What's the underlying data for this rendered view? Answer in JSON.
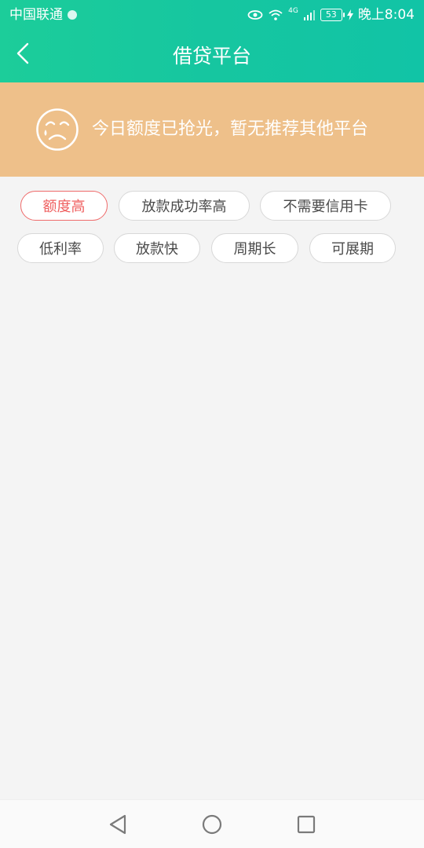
{
  "status_bar": {
    "carrier": "中国联通",
    "network": "4G",
    "battery": "53",
    "time": "晚上8:04"
  },
  "header": {
    "title": "借贷平台"
  },
  "banner": {
    "message": "今日额度已抢光，暂无推荐其他平台"
  },
  "tags": [
    {
      "label": "额度高",
      "selected": true
    },
    {
      "label": "放款成功率高",
      "selected": false
    },
    {
      "label": "不需要信用卡",
      "selected": false
    },
    {
      "label": "低利率",
      "selected": false
    },
    {
      "label": "放款快",
      "selected": false
    },
    {
      "label": "周期长",
      "selected": false
    },
    {
      "label": "可展期",
      "selected": false
    }
  ],
  "colors": {
    "header": "#16c6a0",
    "banner": "#eec08a",
    "selected_tag": "#ef5f5f",
    "background": "#f4f4f4"
  }
}
